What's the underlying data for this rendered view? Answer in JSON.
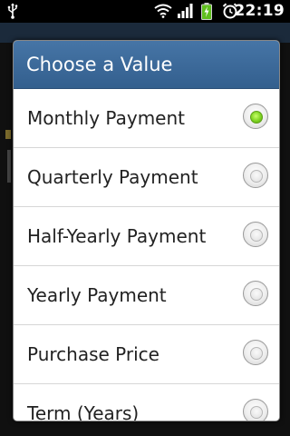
{
  "status_bar": {
    "time": "22:19",
    "icons": [
      "usb-icon",
      "wifi-icon",
      "signal-icon",
      "battery-charging-icon",
      "alarm-icon"
    ]
  },
  "dialog": {
    "title": "Choose a Value",
    "options": [
      {
        "label": "Monthly Payment",
        "checked": true
      },
      {
        "label": "Quarterly Payment",
        "checked": false
      },
      {
        "label": "Half-Yearly Payment",
        "checked": false
      },
      {
        "label": "Yearly Payment",
        "checked": false
      },
      {
        "label": "Purchase Price",
        "checked": false
      },
      {
        "label": "Term (Years)",
        "checked": false
      }
    ]
  },
  "colors": {
    "title_bar": "#3b6898",
    "selected_radio": "#7ed321"
  }
}
